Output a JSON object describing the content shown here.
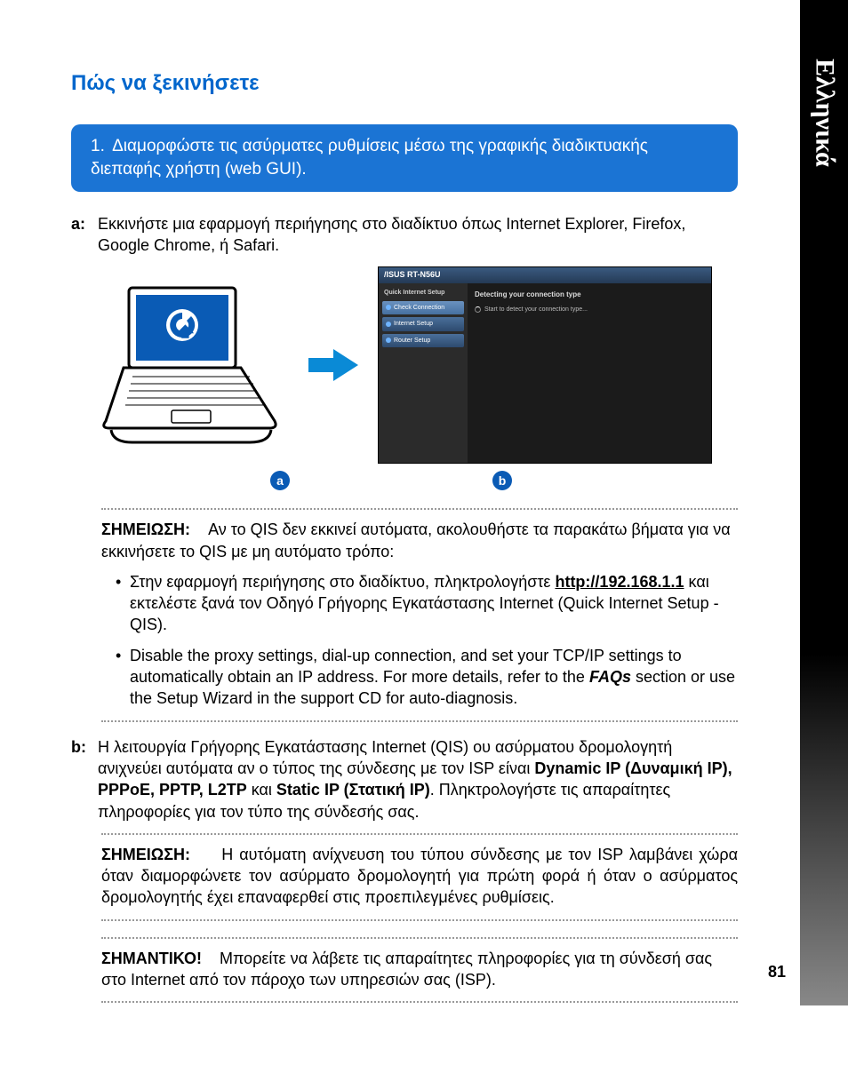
{
  "sidebar": {
    "language": "Ελληνικά"
  },
  "title": "Πώς να ξεκινήσετε",
  "step": {
    "num": "1.",
    "text": "Διαμορφώστε τις ασύρματες ρυθμίσεις μέσω της γραφικής διαδικτυακής διεπαφής χρήστη (web GUI)."
  },
  "a": {
    "label": "a:",
    "text": "Εκκινήστε μια εφαρμογή περιήγησης στο διαδίκτυο όπως Internet  Explorer, Firefox, Google Chrome, ή Safari."
  },
  "screenshot": {
    "router_model": "RT-N56U",
    "side_title": "Quick Internet Setup",
    "btn1": "Check Connection",
    "btn2": "Internet Setup",
    "btn3": "Router Setup",
    "main_title": "Detecting your connection type",
    "main_line": "Start to detect your connection type..."
  },
  "badge_a": "a",
  "badge_b": "b",
  "note1": {
    "label": "ΣΗΜΕΙΩΣΗ:",
    "text": "Αν το QIS δεν εκκινεί αυτόματα, ακολουθήστε τα παρακάτω βήματα για να εκκινήσετε το QIS με μη αυτόματο τρόπο:"
  },
  "bullet1": {
    "pre": "Στην εφαρμογή περιήγησης στο διαδίκτυο, πληκτρολογήστε ",
    "url": "http://192.168.1.1",
    "post": " και εκτελέστε ξανά τον Οδηγό Γρήγορης Εγκατάστασης Internet (Quick Internet Setup - QIS)."
  },
  "bullet2": {
    "pre": "Disable the proxy settings, dial-up connection, and set your TCP/IP settings to automatically obtain an IP address. For more details, refer to the ",
    "faqs": "FAQs",
    "post": " section or use the Setup Wizard in the support CD for auto-diagnosis."
  },
  "b": {
    "label": "b:",
    "pre": "Η λειτουργία Γρήγορης Εγκατάστασης Internet (QIS) ου ασύρματου δρομολογητή ανιχνεύει αυτόματα αν ο τύπος της σύνδεσης με τον ISP είναι ",
    "b1": "Dynamic IP (Δυναμική IP), PPPoE, PPTP, L2TP",
    "mid": " και ",
    "b2": "Static IP (Στατική IP)",
    "post": ". Πληκτρολογήστε τις απαραίτητες πληροφορίες για τον τύπο της σύνδεσής σας."
  },
  "note2": {
    "label": "ΣΗΜΕΙΩΣΗ:",
    "text": "Η αυτόματη ανίχνευση του τύπου σύνδεσης με τον ISP λαμβάνει χώρα όταν διαμορφώνετε τον ασύρματο δρομολογητή για πρώτη φορά ή όταν ο ασύρματος δρομολογητής έχει επαναφερθεί στις προεπιλεγμένες ρυθμίσεις."
  },
  "important": {
    "label": "ΣΗΜΑΝΤΙΚΟ!",
    "text": "Μπορείτε να λάβετε τις απαραίτητες πληροφορίες για τη σύνδεσή σας στο Internet από τον πάροχο των υπηρεσιών σας (ISP)."
  },
  "page_number": "81"
}
